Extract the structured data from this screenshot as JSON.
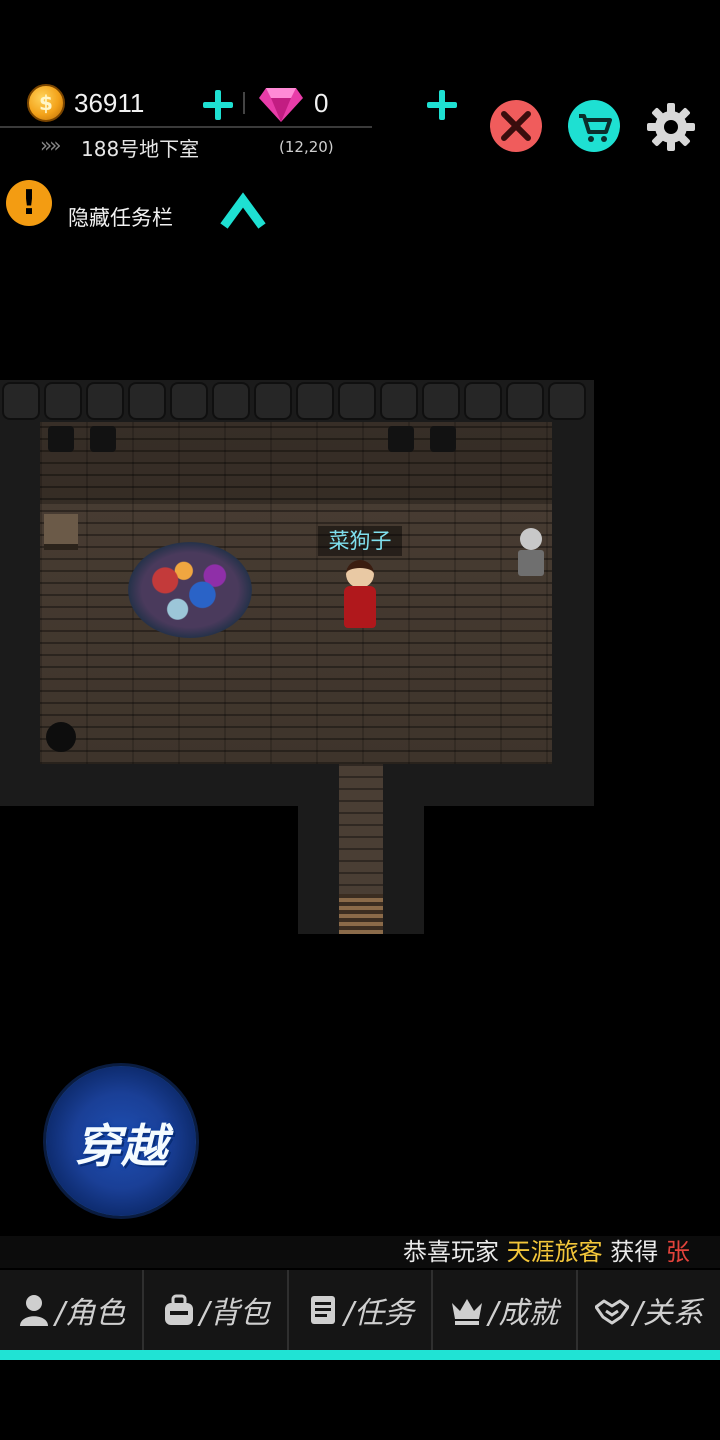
{
  "hud": {
    "gold": "36911",
    "gems": "0",
    "location": "188号地下室",
    "coords": "(12,20)",
    "location_arrow": "»»",
    "coin_icon": "coin-icon",
    "gem_icon": "gem-icon",
    "colors": {
      "accent": "#1ee0d2",
      "battle": "#f05c5c",
      "shop": "#1ee0d2"
    }
  },
  "quest": {
    "alert_glyph": "!",
    "label": "隐藏任务栏"
  },
  "map": {
    "npc_name": "菜狗子"
  },
  "warp": {
    "label": "穿越"
  },
  "ticker": {
    "prefix": "恭喜玩家",
    "player": "天涯旅客",
    "verb": "获得",
    "item": "张"
  },
  "nav": {
    "items": [
      {
        "label": "/角色",
        "icon": "person-icon"
      },
      {
        "label": "/背包",
        "icon": "bag-icon"
      },
      {
        "label": "/任务",
        "icon": "scroll-icon"
      },
      {
        "label": "/成就",
        "icon": "crown-icon"
      },
      {
        "label": "/关系",
        "icon": "handshake-icon"
      }
    ]
  }
}
